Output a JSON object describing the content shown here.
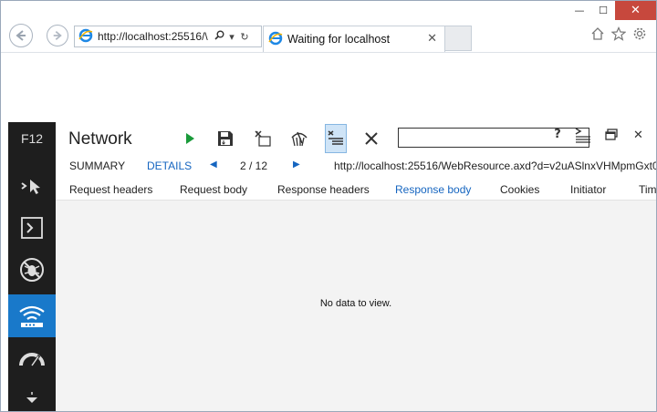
{
  "browser": {
    "address": "http://localhost:25516/\\",
    "tab_title": "Waiting for localhost",
    "tab_close": "✕",
    "addr_search_icon": "search-icon",
    "addr_dropdown": "▾",
    "addr_refresh": "↻",
    "window_controls": {
      "minimize": "—",
      "maximize": "☐",
      "close": "✕"
    },
    "right_icons": [
      "home-icon",
      "star-icon",
      "gear-icon"
    ]
  },
  "devtools": {
    "f12_label": "F12",
    "tool_title": "Network",
    "search_placeholder": "",
    "help_label": "?",
    "close_label": "✕",
    "sidebar": [
      {
        "name": "dom-explorer",
        "icon": "cursor-icon",
        "active": false
      },
      {
        "name": "console",
        "icon": "console-icon",
        "active": false
      },
      {
        "name": "debugger",
        "icon": "bug-icon",
        "active": false
      },
      {
        "name": "network",
        "icon": "wifi-icon",
        "active": true
      },
      {
        "name": "performance",
        "icon": "gauge-icon",
        "active": false
      },
      {
        "name": "more",
        "icon": "chevron-down-icon",
        "active": false
      }
    ],
    "subbar": {
      "summary": "SUMMARY",
      "details": "DETAILS",
      "counter": "2 / 12",
      "url": "http://localhost:25516/WebResource.axd?d=v2uASlnxVHMpmGxt0"
    },
    "detail_tabs": [
      "Request headers",
      "Request body",
      "Response headers",
      "Response body",
      "Cookies",
      "Initiator",
      "Tim"
    ],
    "active_detail_tab": "Response body",
    "empty_message": "No data to view."
  },
  "colors": {
    "sidebar_bg": "#1e1e1e",
    "sidebar_active": "#1979ca",
    "link_blue": "#1565c0",
    "play_green": "#1a9a3a",
    "close_red": "#c7483d"
  }
}
